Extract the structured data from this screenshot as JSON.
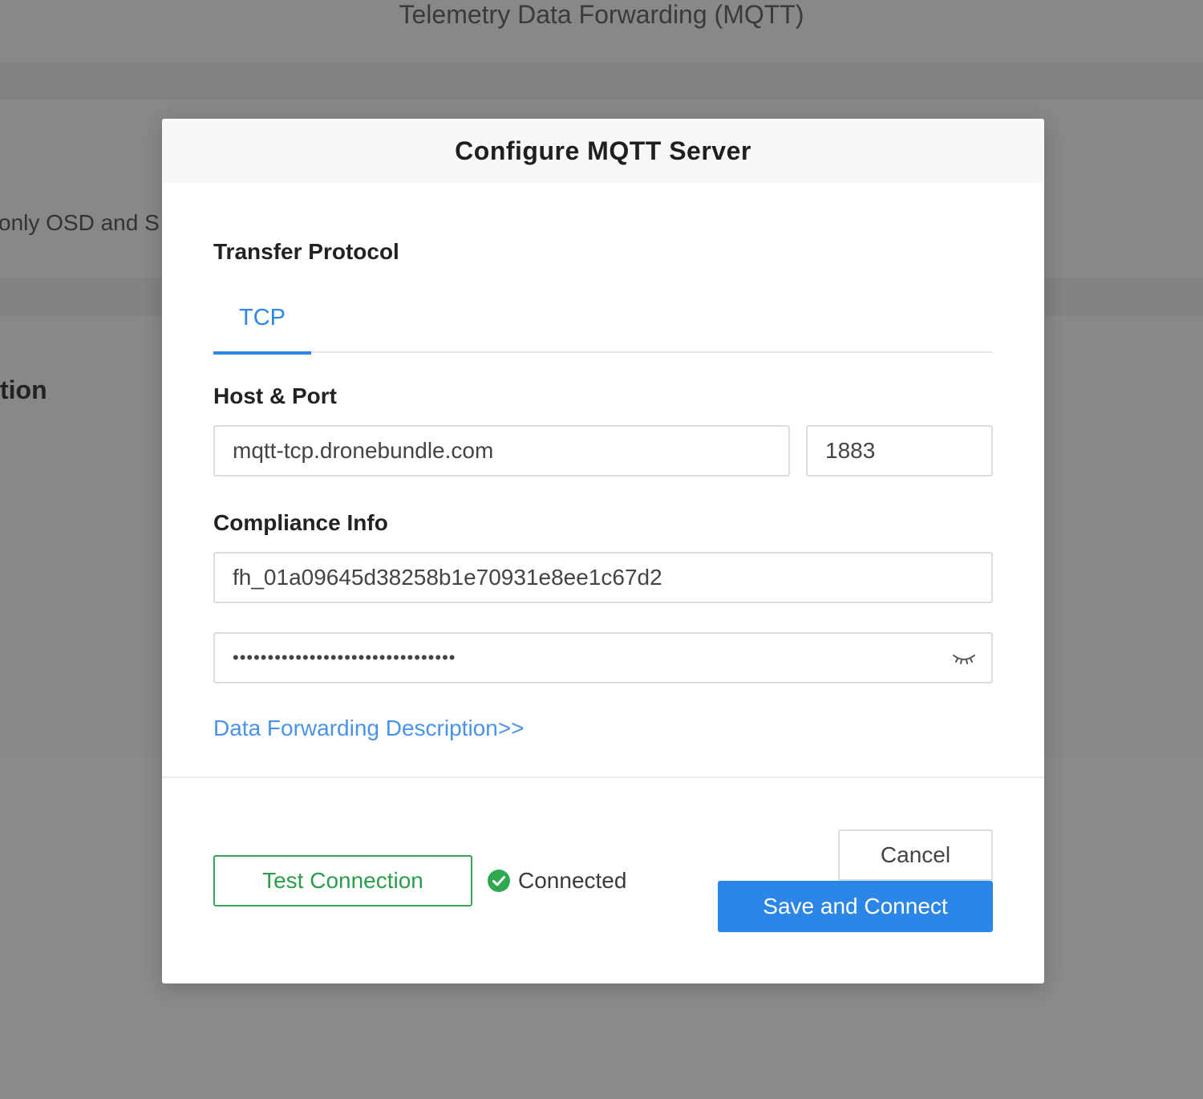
{
  "background": {
    "page_title": "Telemetry Data Forwarding (MQTT)",
    "partial_text": "only OSD and S",
    "partial_heading": "tion"
  },
  "modal": {
    "title": "Configure MQTT Server",
    "transfer_protocol_label": "Transfer Protocol",
    "tabs": [
      {
        "label": "TCP",
        "selected": true
      }
    ],
    "host_port_label": "Host & Port",
    "host": "mqtt-tcp.dronebundle.com",
    "port": "1883",
    "compliance_label": "Compliance Info",
    "compliance_id": "fh_01a09645d38258b1e70931e8ee1c67d2",
    "compliance_secret_masked": "••••••••••••••••••••••••••••••••",
    "description_link": "Data Forwarding Description>>",
    "test_button": "Test Connection",
    "status_text": "Connected",
    "cancel_button": "Cancel",
    "save_button": "Save and Connect"
  },
  "colors": {
    "accent": "#2b86e8",
    "success": "#2a9d4a",
    "link": "#4a93e6",
    "overlay": "#888888"
  },
  "icons": {
    "password_toggle": "eye-closed-icon",
    "status": "check-circle-icon"
  }
}
